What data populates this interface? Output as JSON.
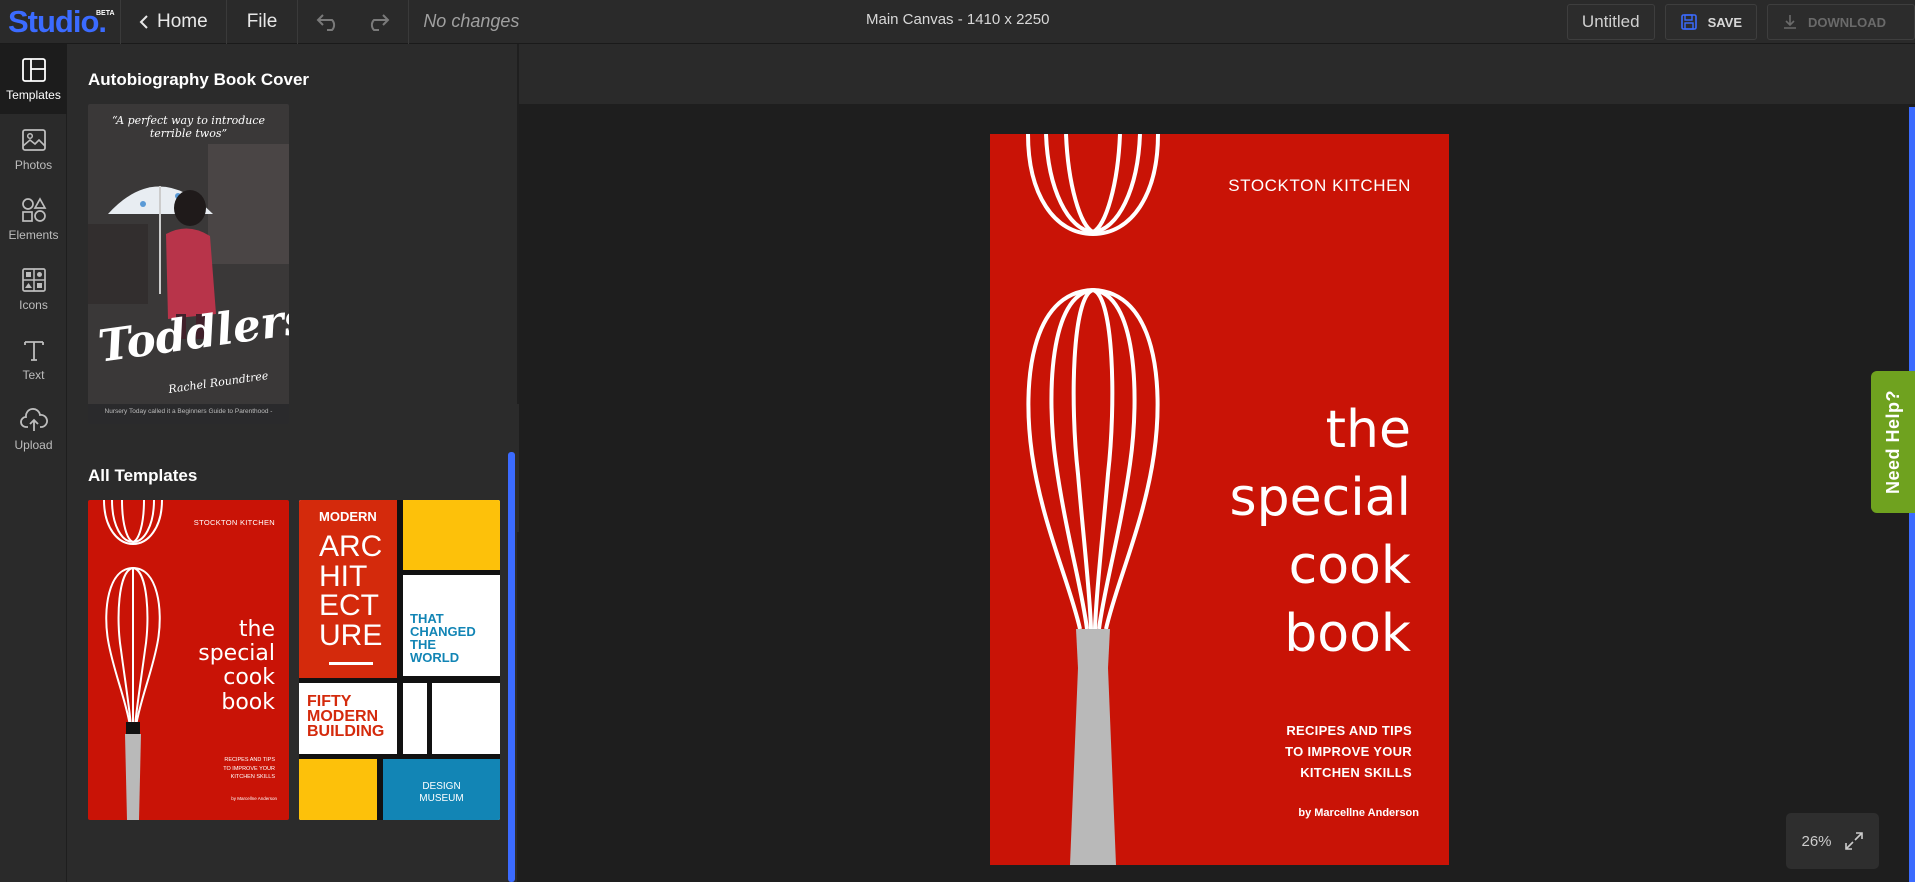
{
  "app": {
    "logo_text": "Studio.",
    "logo_badge": "BETA",
    "brand_color": "#3b6bff"
  },
  "toolbar": {
    "home_label": "Home",
    "file_label": "File",
    "status_text": "No changes",
    "canvas_info": "Main Canvas - 1410 x 2250",
    "doc_title": "Untitled",
    "save_label": "SAVE",
    "download_label": "DOWNLOAD"
  },
  "rail": {
    "items": [
      {
        "label": "Templates",
        "icon": "layout-icon"
      },
      {
        "label": "Photos",
        "icon": "image-icon"
      },
      {
        "label": "Elements",
        "icon": "shapes-icon"
      },
      {
        "label": "Icons",
        "icon": "icons-grid-icon"
      },
      {
        "label": "Text",
        "icon": "text-icon"
      },
      {
        "label": "Upload",
        "icon": "upload-cloud-icon"
      }
    ]
  },
  "panel": {
    "section1_title": "Autobiography Book Cover",
    "section2_title": "All Templates",
    "toddlers": {
      "quote": "“A perfect way to introduce terrible twos”",
      "title": "Toddlers",
      "author": "Rachel Roundtree",
      "footer": "Nursery Today called it a Beginners Guide to Parenthood -"
    },
    "cookbook_thumb": {
      "publisher": "STOCKTON KITCHEN",
      "title": [
        "the",
        "special",
        "cook",
        "book"
      ],
      "tagline": [
        "RECIPES AND TIPS",
        "TO IMPROVE YOUR",
        "KITCHEN SKILLS"
      ],
      "author": "by Marcellne Anderson"
    },
    "architecture_thumb": {
      "top": "MODERN",
      "big": [
        "ARC",
        "HIT",
        "ECT",
        "URE"
      ],
      "side": [
        "THAT",
        "CHANGED",
        "THE",
        "WORLD"
      ],
      "fifty": [
        "FIFTY",
        "MODERN",
        "BUILDING"
      ],
      "museum": [
        "DESIGN",
        "MUSEUM"
      ]
    }
  },
  "canvas": {
    "publisher": "STOCKTON KITCHEN",
    "title_lines": [
      "the",
      "special",
      "cook",
      "book"
    ],
    "tagline_lines": [
      "RECIPES AND TIPS",
      "TO IMPROVE YOUR",
      "KITCHEN SKILLS"
    ],
    "author": "by Marcellne Anderson",
    "bg_color": "#c91306"
  },
  "zoom": {
    "level": "26%"
  },
  "help": {
    "label": "Need Help?"
  }
}
